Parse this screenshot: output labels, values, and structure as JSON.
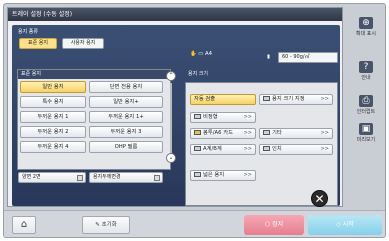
{
  "dialog": {
    "title": "트레이 설정 (수동 설정)"
  },
  "paper_type": {
    "section_label": "용지 종류",
    "tabs": [
      {
        "label": "표준 용지",
        "active": true
      },
      {
        "label": "사용자 용지",
        "active": false
      }
    ],
    "list_header": "표준 용지",
    "buttons": [
      {
        "label": "일반 용지",
        "selected": true
      },
      {
        "label": "단면 전용 용지",
        "selected": false
      },
      {
        "label": "특수 용지",
        "selected": false
      },
      {
        "label": "일반 용지+",
        "selected": false
      },
      {
        "label": "두꺼운 용지 1",
        "selected": false
      },
      {
        "label": "두꺼운 용지 1+",
        "selected": false
      },
      {
        "label": "두꺼운 용지 2",
        "selected": false
      },
      {
        "label": "두꺼운 용지 3",
        "selected": false
      },
      {
        "label": "두꺼운 용지 4",
        "selected": false
      },
      {
        "label": "OHP 필름",
        "selected": false
      }
    ],
    "bottom_options": [
      {
        "label": "양면 2면"
      },
      {
        "label": "용지두께변경"
      }
    ]
  },
  "status": {
    "orientation": "A4",
    "paper_weight": "60 - 90g/㎡"
  },
  "paper_size": {
    "section_label": "용지 크기",
    "buttons": [
      {
        "label": "자동 검출",
        "selected": true,
        "arrow": ""
      },
      {
        "label": "용지 크기 지정",
        "selected": false,
        "arrow": ">>"
      },
      {
        "label": "비정형",
        "selected": false,
        "arrow": ">>"
      },
      {
        "label": "봉투/A6 카드",
        "selected": false,
        "arrow": ">>"
      },
      {
        "label": "기타",
        "selected": false,
        "arrow": ">>"
      },
      {
        "label": "A계/B계",
        "selected": false,
        "arrow": ">>"
      },
      {
        "label": "인치",
        "selected": false,
        "arrow": ">>"
      },
      {
        "label": "넓은 용지",
        "selected": false,
        "arrow": ">>"
      }
    ]
  },
  "sidebar": {
    "items": [
      {
        "label": "확대 표시",
        "icon": "zoom-icon"
      },
      {
        "label": "안내",
        "icon": "help-icon"
      },
      {
        "label": "인터럽트",
        "icon": "interrupt-icon"
      },
      {
        "label": "미리보기",
        "icon": "preview-icon"
      }
    ]
  },
  "bottom": {
    "reset_label": "초기화",
    "stop_label": "정지",
    "start_label": "시작"
  },
  "colors": {
    "title_bar": "#3a4456",
    "panel_blue": "#32456a",
    "selected_yellow": "#f6d266",
    "stop_pink": "#ee8fa0",
    "start_cyan": "#9adcf0"
  }
}
